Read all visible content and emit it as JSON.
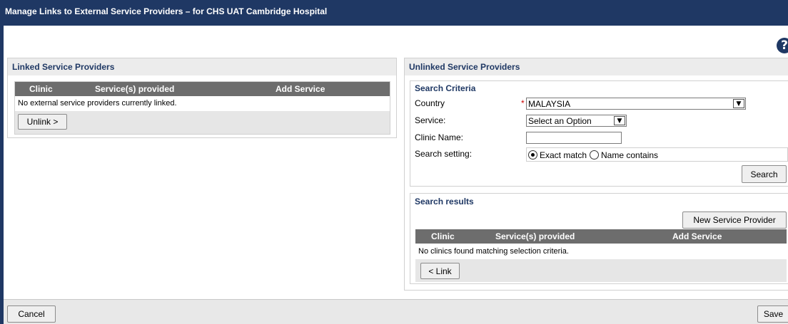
{
  "window": {
    "title": "Manage Links to External Service Providers – for CHS UAT Cambridge Hospital"
  },
  "help": {
    "glyph": "?"
  },
  "linked": {
    "title": "Linked Service Providers",
    "columns": [
      "Clinic",
      "Service(s) provided",
      "Add Service"
    ],
    "empty_text": "No external service providers currently linked.",
    "unlink_label": "Unlink >"
  },
  "unlinked": {
    "title": "Unlinked Service Providers",
    "criteria": {
      "title": "Search Criteria",
      "country_label": "Country",
      "required_mark": "*",
      "country_value": "MALAYSIA",
      "service_label": "Service:",
      "service_value": "Select an Option",
      "clinic_name_label": "Clinic Name:",
      "clinic_name_value": "",
      "search_setting_label": "Search setting:",
      "options": [
        "Exact match",
        "Name contains"
      ],
      "selected_option": "Exact match",
      "search_label": "Search"
    },
    "results": {
      "title": "Search results",
      "new_provider_label": "New Service Provider",
      "columns": [
        "Clinic",
        "Service(s) provided",
        "Add Service"
      ],
      "empty_text": "No clinics found matching selection criteria.",
      "link_label": "< Link"
    }
  },
  "footer": {
    "cancel_label": "Cancel",
    "save_label": "Save"
  },
  "colors": {
    "titlebar": "#1f3864",
    "grid_header": "#6d6d6d",
    "required": "#cc0000"
  },
  "icons": {
    "help": "help-icon",
    "dropdown": "chevron-down-icon"
  }
}
